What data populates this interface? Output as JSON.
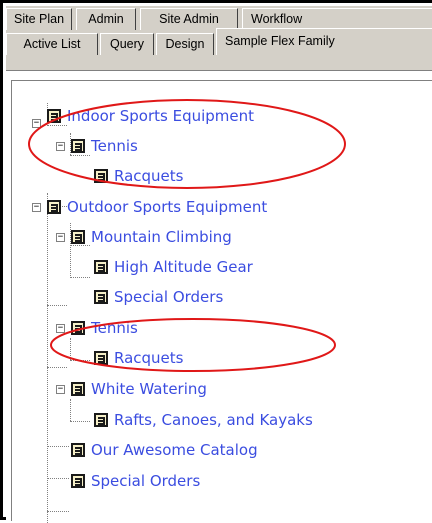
{
  "tabs": {
    "row1": [
      {
        "label": "Site Plan"
      },
      {
        "label": "Admin"
      },
      {
        "label": "Site Admin"
      },
      {
        "label": "Workflow"
      }
    ],
    "row2": [
      {
        "label": "Active List"
      },
      {
        "label": "Query"
      },
      {
        "label": "Design"
      },
      {
        "label": "Sample Flex Family",
        "selected": true
      }
    ]
  },
  "tree": {
    "nodes": [
      {
        "label": "Indoor Sports Equipment",
        "level": 0,
        "expanded": true
      },
      {
        "label": "Tennis",
        "level": 1,
        "expanded": true
      },
      {
        "label": "Racquets",
        "level": 2
      },
      {
        "label": "Outdoor Sports Equipment",
        "level": 0,
        "expanded": true
      },
      {
        "label": "Mountain Climbing",
        "level": 1,
        "expanded": true
      },
      {
        "label": "High Altitude Gear",
        "level": 2
      },
      {
        "label": "Special Orders",
        "level": 2
      },
      {
        "label": "Tennis",
        "level": 1,
        "expanded": true
      },
      {
        "label": "Racquets",
        "level": 2
      },
      {
        "label": "White Watering",
        "level": 1,
        "expanded": true
      },
      {
        "label": "Rafts, Canoes, and Kayaks",
        "level": 2
      },
      {
        "label": "Our Awesome Catalog",
        "level": 1
      },
      {
        "label": "Special Orders",
        "level": 1
      }
    ]
  },
  "colors": {
    "node_text": "#3b4de0",
    "highlight_oval": "#e01818",
    "tab_face": "#d4d0c8"
  },
  "icons": {
    "node": "document-icon",
    "expanded": "minus-box-icon"
  }
}
